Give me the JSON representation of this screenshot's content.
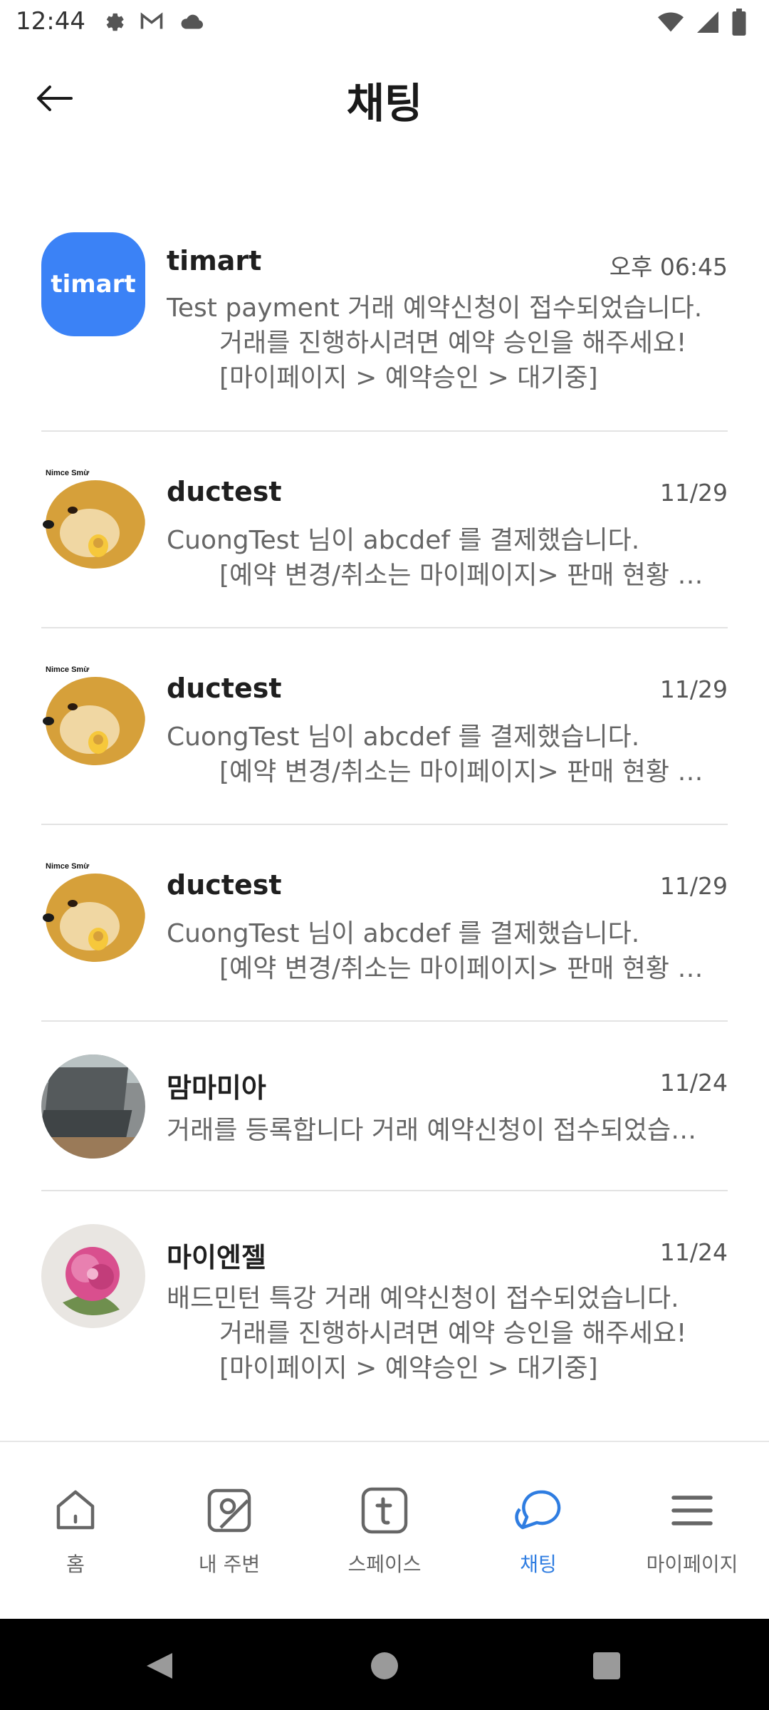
{
  "status_bar": {
    "time": "12:44",
    "left_icons": [
      "gear-icon",
      "gmail-icon",
      "cloud-icon"
    ],
    "right_icons": [
      "wifi-icon",
      "signal-icon",
      "battery-icon"
    ]
  },
  "header": {
    "title": "채팅"
  },
  "chats": [
    {
      "name": "timart",
      "time": "오후 06:45",
      "avatar": "timart-logo",
      "avatar_text": "timart",
      "lines": [
        "Test payment 거래 예약신청이 접수되었습니다.",
        "거래를 진행하시려면 예약 승인을 해주세요!",
        "[마이페이지 > 예약승인 > 대기중]"
      ]
    },
    {
      "name": "ductest",
      "time": "11/29",
      "avatar": "shiba-ok-meme",
      "avatar_caption": "Nimce Smừ",
      "lines": [
        "CuongTest 님이 abcdef 를 결제했습니다.",
        "[예약 변경/취소는 마이페이지> 판매 현황 …"
      ]
    },
    {
      "name": "ductest",
      "time": "11/29",
      "avatar": "shiba-ok-meme",
      "avatar_caption": "Nimce Smừ",
      "lines": [
        "CuongTest 님이 abcdef 를 결제했습니다.",
        "[예약 변경/취소는 마이페이지> 판매 현황 …"
      ]
    },
    {
      "name": "ductest",
      "time": "11/29",
      "avatar": "shiba-ok-meme",
      "avatar_caption": "Nimce Smừ",
      "lines": [
        "CuongTest 님이 abcdef 를 결제했습니다.",
        "[예약 변경/취소는 마이페이지> 판매 현황 …"
      ]
    },
    {
      "name": "맘마미아",
      "time": "11/24",
      "avatar": "laptop-photo",
      "lines": [
        "거래를 등록합니다 거래 예약신청이 접수되었습…"
      ]
    },
    {
      "name": "마이엔젤",
      "time": "11/24",
      "avatar": "peony-photo",
      "lines": [
        "배드민턴 특강 거래 예약신청이 접수되었습니다.",
        "거래를 진행하시려면 예약 승인을 해주세요!",
        "[마이페이지 > 예약승인 > 대기중]"
      ]
    }
  ],
  "bottom_nav": {
    "items": [
      {
        "label": "홈",
        "icon": "home-icon",
        "active": false
      },
      {
        "label": "내 주변",
        "icon": "map-icon",
        "active": false
      },
      {
        "label": "스페이스",
        "icon": "space-icon",
        "active": false
      },
      {
        "label": "채팅",
        "icon": "chat-icon",
        "active": true
      },
      {
        "label": "마이페이지",
        "icon": "menu-icon",
        "active": false
      }
    ]
  },
  "colors": {
    "accent": "#2f7de1",
    "timart_blue": "#3b82f6",
    "divider": "#e3e3e3"
  }
}
